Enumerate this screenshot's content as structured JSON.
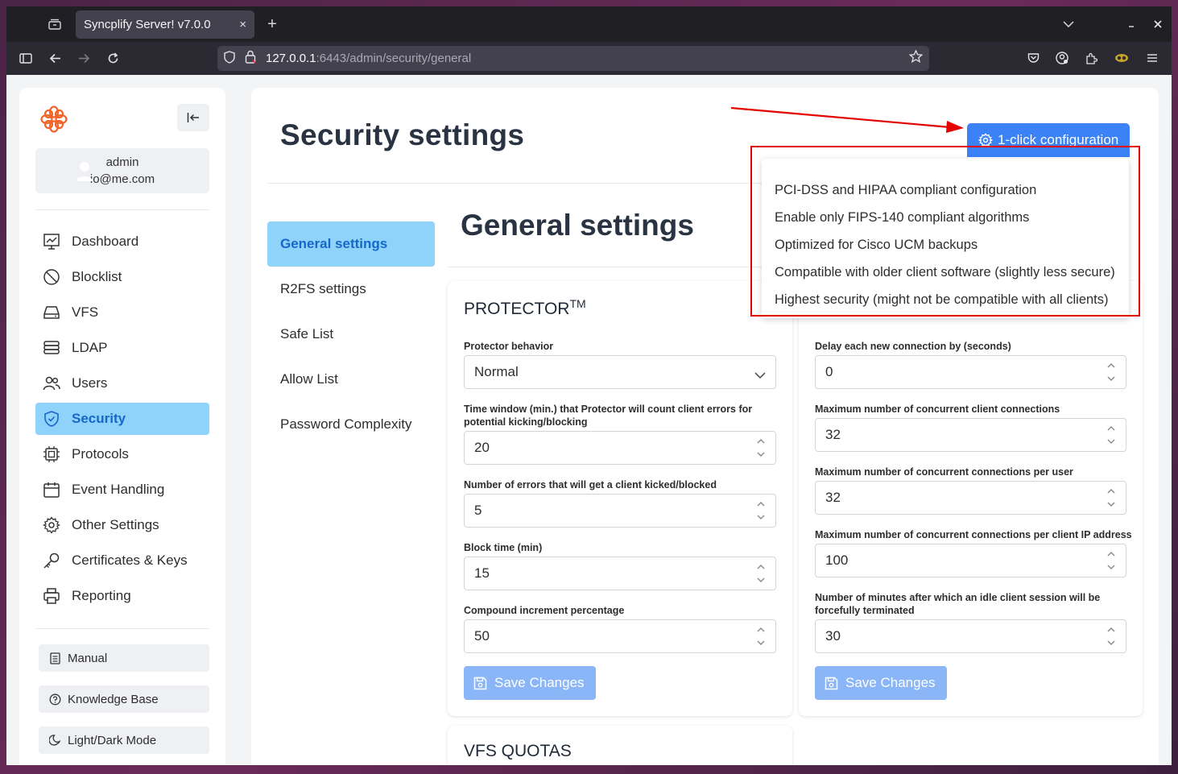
{
  "browser": {
    "tab_title": "Syncplify Server! v7.0.0",
    "tab_close": "×",
    "new_tab": "+",
    "url_host": "127.0.0.1",
    "url_path": ":6443/admin/security/general"
  },
  "sidebar": {
    "user_name": "admin",
    "user_email": "io@me.com",
    "items": [
      {
        "label": "Dashboard",
        "icon": "dashboard-icon"
      },
      {
        "label": "Blocklist",
        "icon": "blocked-icon"
      },
      {
        "label": "VFS",
        "icon": "drive-icon"
      },
      {
        "label": "LDAP",
        "icon": "database-icon"
      },
      {
        "label": "Users",
        "icon": "users-icon"
      },
      {
        "label": "Security",
        "icon": "shield-icon"
      },
      {
        "label": "Protocols",
        "icon": "chip-icon"
      },
      {
        "label": "Event Handling",
        "icon": "calendar-icon"
      },
      {
        "label": "Other Settings",
        "icon": "gear-icon"
      },
      {
        "label": "Certificates & Keys",
        "icon": "key-icon"
      },
      {
        "label": "Reporting",
        "icon": "printer-icon"
      }
    ],
    "buttons": [
      {
        "label": "Manual",
        "icon": "book-icon"
      },
      {
        "label": "Knowledge Base",
        "icon": "help-icon"
      },
      {
        "label": "Light/Dark Mode",
        "icon": "moon-icon"
      }
    ]
  },
  "main": {
    "title": "Security settings",
    "config_button": "1-click configuration",
    "section_title": "General settings",
    "subnav": [
      "General settings",
      "R2FS settings",
      "Safe List",
      "Allow List",
      "Password Complexity"
    ]
  },
  "dropdown": {
    "items": [
      "PCI-DSS and HIPAA compliant configuration",
      "Enable only FIPS-140 compliant algorithms",
      "Optimized for Cisco UCM backups",
      "Compatible with older client software (slightly less secure)",
      "Highest security (might not be compatible with all clients)"
    ]
  },
  "protector": {
    "title": "PROTECTOR",
    "tm": "TM",
    "behavior_label": "Protector behavior",
    "behavior_value": "Normal",
    "time_window_label": "Time window (min.) that Protector will count client errors for potential kicking/blocking",
    "time_window_value": "20",
    "errors_label": "Number of errors that will get a client kicked/blocked",
    "errors_value": "5",
    "block_time_label": "Block time (min)",
    "block_time_value": "15",
    "compound_label": "Compound increment percentage",
    "compound_value": "50",
    "save_label": "Save Changes"
  },
  "connections": {
    "delay_label": "Delay each new connection by (seconds)",
    "delay_value": "0",
    "max_client_label": "Maximum number of concurrent client connections",
    "max_client_value": "32",
    "max_user_label": "Maximum number of concurrent connections per user",
    "max_user_value": "32",
    "max_ip_label": "Maximum number of concurrent connections per client IP address",
    "max_ip_value": "100",
    "idle_label": "Number of minutes after which an idle client session will be forcefully terminated",
    "idle_value": "30",
    "save_label": "Save Changes"
  },
  "vfs_quotas": {
    "title": "VFS QUOTAS"
  },
  "colors": {
    "accent": "#3b82f6",
    "active_bg": "#8fd3fb",
    "active_text": "#1668c8",
    "annotation": "#e30000"
  }
}
